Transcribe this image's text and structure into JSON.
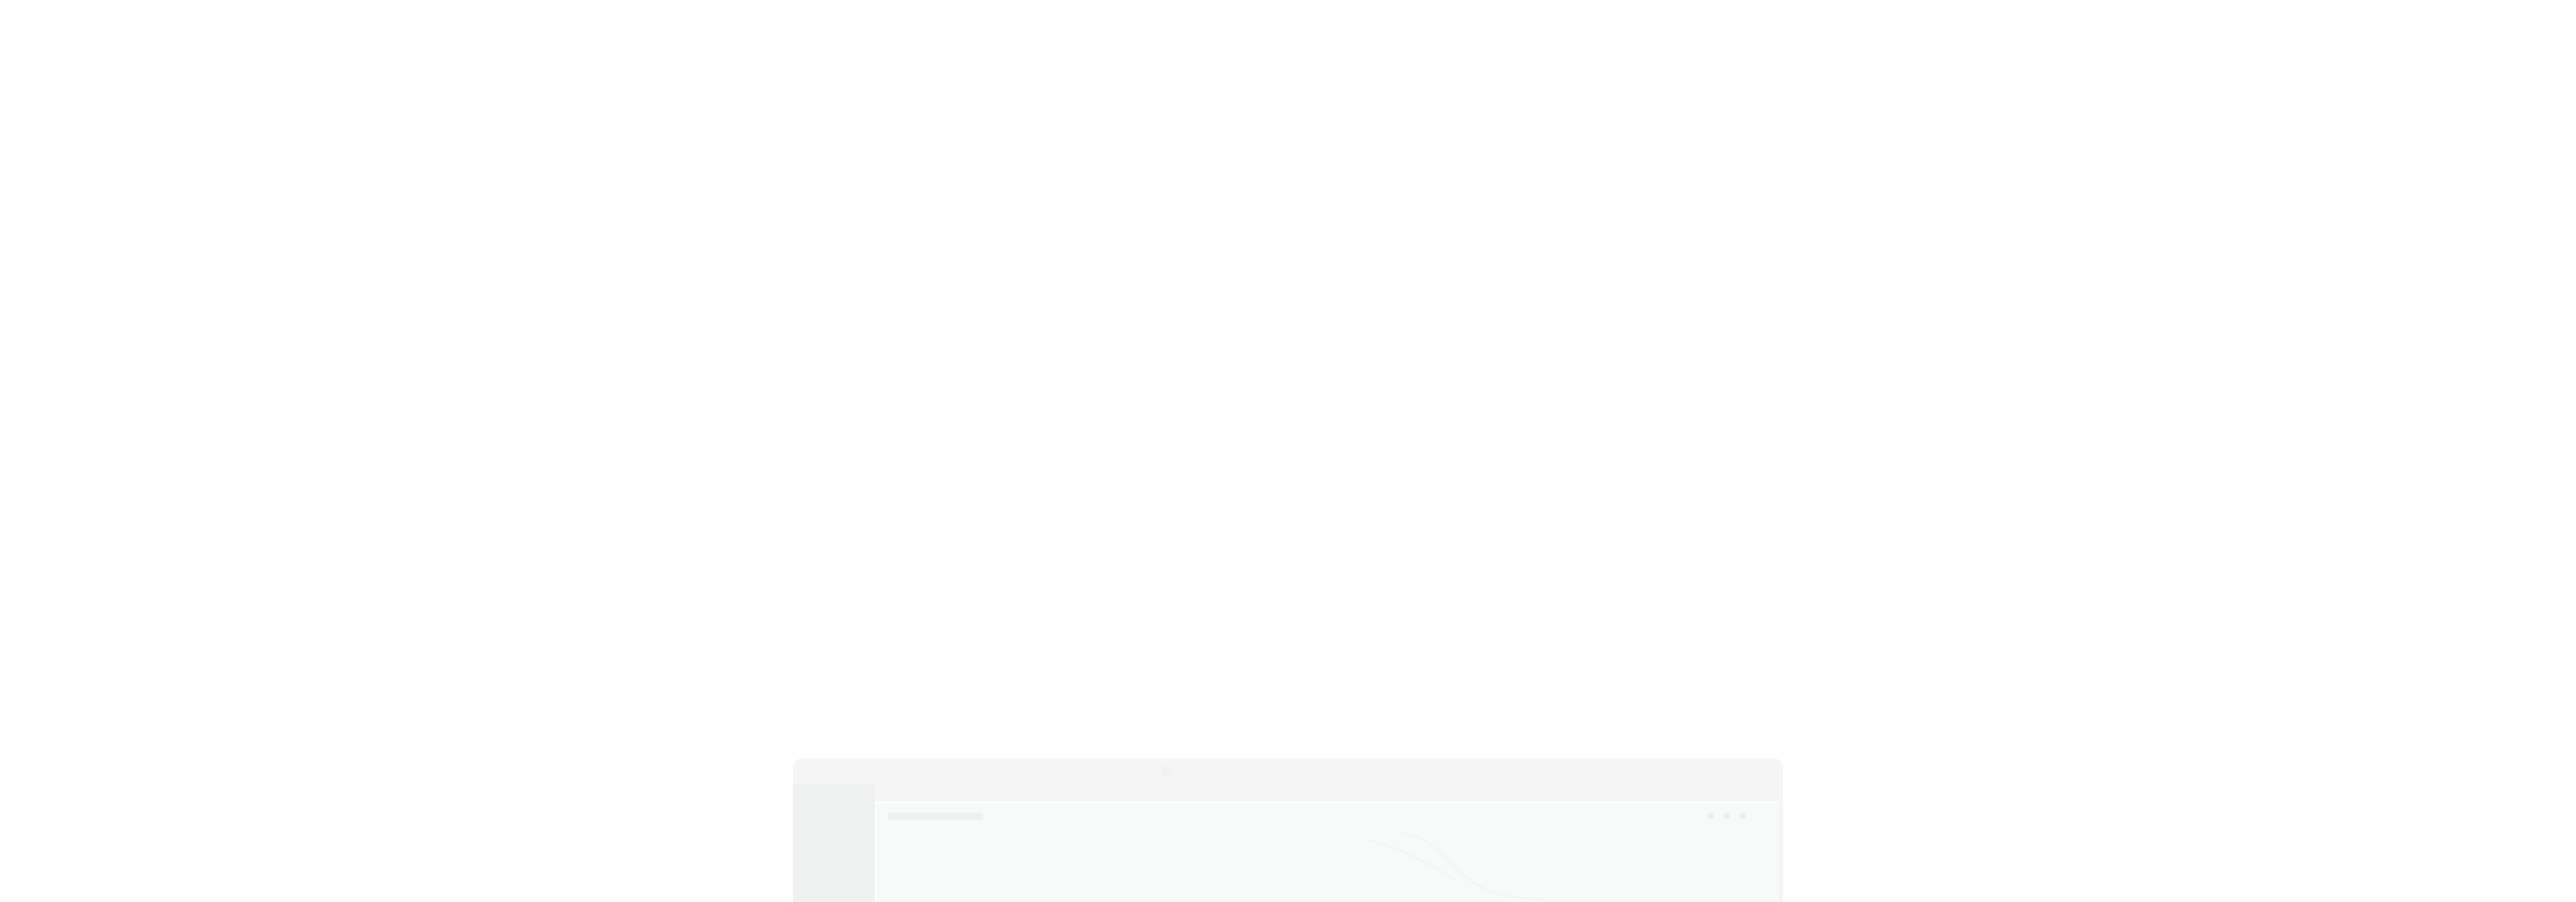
{
  "window": {
    "title": ""
  },
  "toolbar": {
    "label": "",
    "icons": [
      "dot-icon",
      "dot-icon",
      "dot-icon"
    ]
  },
  "colors": {
    "background": "#ffffff",
    "window": "#f4f5f5",
    "panel": "#f8f9f9"
  }
}
